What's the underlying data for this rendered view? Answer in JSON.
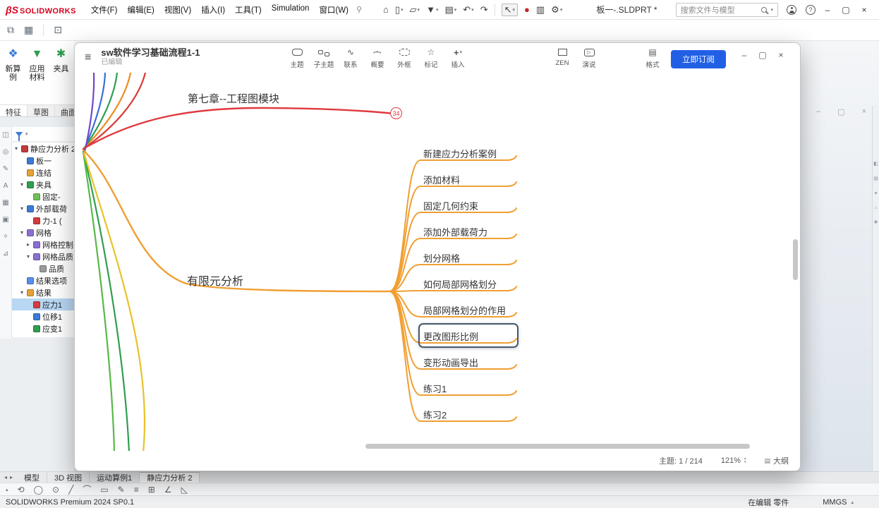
{
  "colors": {
    "brand_red": "#d6001c",
    "subscribe_blue": "#2160e5",
    "branch_orange": "#f09f33",
    "branch_red": "#e0393f",
    "tree_selection_blue": "#b8d7f3"
  },
  "icons": {
    "pin": "⚲",
    "caret": "▾",
    "help": "?",
    "minimize": "–",
    "maximize": "▢",
    "close": "×",
    "hamburger": "≡",
    "relation": "∿",
    "marker": "☆",
    "plus": "+",
    "play": "▷",
    "format": "▤",
    "brace": "{",
    "up": "▴",
    "down": "▾",
    "left": "◂",
    "right": "▸",
    "outline": "▤"
  },
  "qat_icons": {
    "home": "⌂",
    "new": "▯",
    "open": "▱",
    "save": "▼",
    "print": "▤",
    "undo": "↶",
    "redo": "↷",
    "select": "↖",
    "sphere": "●",
    "sheet": "▥",
    "gear": "⚙"
  },
  "row2_icons": [
    "⧉",
    "▦",
    "⊡"
  ],
  "left_strip_icons": [
    "◫",
    "◎",
    "✎",
    "A",
    "▦",
    "▣",
    "✧",
    "⊿"
  ],
  "taskpane_icons": [
    "◧",
    "▤",
    "✦",
    "⌂",
    "❖"
  ],
  "ghost_icons": [
    "⧉",
    "–",
    "▢",
    "×"
  ],
  "sketch_icons": [
    "⟲",
    "◯",
    "⊙",
    "╱",
    "⌒",
    "▭",
    "✎",
    "≡",
    "⊞",
    "∠",
    "◺"
  ],
  "titlebar": {
    "logo_mark": "βS",
    "logo_text": "SOLIDWORKS",
    "menus": [
      "文件(F)",
      "编辑(E)",
      "视图(V)",
      "插入(I)",
      "工具(T)",
      "Simulation",
      "窗口(W)"
    ],
    "doc_title": "板一-.SLDPRT *",
    "search_placeholder": "搜索文件与模型"
  },
  "cmd_panel": {
    "buttons": [
      "新算例",
      "应用材料",
      "夹具"
    ]
  },
  "cmd_tabs": [
    "特征",
    "草图",
    "曲面"
  ],
  "tree": [
    {
      "arrow": "▾",
      "label": "静应力分析 2",
      "icon_style": "background:#c23b3b"
    },
    {
      "arrow": "",
      "label": "板一",
      "icon_style": "background:#3a7bd5"
    },
    {
      "arrow": "",
      "label": "连结",
      "icon_style": "background:#e2a33c"
    },
    {
      "arrow": "▾",
      "label": "夹具",
      "icon_style": "background:#2e9e4f"
    },
    {
      "arrow": "",
      "label": "固定-",
      "icon_style": "background:#6fbf5a"
    },
    {
      "arrow": "▾",
      "label": "外部载荷",
      "icon_style": "background:#3a7bd5"
    },
    {
      "arrow": "",
      "label": "力-1 (",
      "icon_style": "background:#d23c3c"
    },
    {
      "arrow": "▾",
      "label": "网格",
      "icon_style": "background:#8a6fd1"
    },
    {
      "arrow": "▸",
      "label": "网格控制",
      "icon_style": "background:#8a6fd1"
    },
    {
      "arrow": "▾",
      "label": "网格品质",
      "icon_style": "background:#8a6fd1"
    },
    {
      "arrow": "",
      "label": "品质",
      "icon_style": "background:#9a9a9a"
    },
    {
      "arrow": "",
      "label": "结果选项",
      "icon_style": "background:#5b8def"
    },
    {
      "arrow": "▾",
      "label": "结果",
      "icon_style": "background:#e2a33c"
    },
    {
      "arrow": "",
      "label": "应力1",
      "icon_style": "background:#d23c3c"
    },
    {
      "arrow": "",
      "label": "位移1",
      "icon_style": "background:#3a7bd5"
    },
    {
      "arrow": "",
      "label": "应变1",
      "icon_style": "background:#2e9e4f"
    }
  ],
  "doc_tabs": [
    "模型",
    "3D 视图",
    "运动算例1",
    "静应力分析 2"
  ],
  "status_bar": {
    "left": "SOLIDWORKS Premium 2024 SP0.1",
    "editing": "在编辑 零件",
    "units": "MMGS"
  },
  "mindmap": {
    "title": "sw软件学习基础流程1-1",
    "subtitle": "已编辑",
    "toolbar": [
      "主题",
      "子主题",
      "联系",
      "概要",
      "外框",
      "标记",
      "插入"
    ],
    "zen": "ZEN",
    "present": "演说",
    "format": "格式",
    "subscribe": "立即订阅",
    "chapter7": "第七章--工程图模块",
    "badge": "34",
    "fea": "有限元分析",
    "children": [
      "新建应力分析案例",
      "添加材料",
      "固定几何约束",
      "添加外部载荷力",
      "划分网格",
      "如何局部网格划分",
      "局部网格划分的作用",
      "更改图形比例",
      "变形动画导出",
      "练习1",
      "练习2"
    ],
    "status": {
      "topics": "主题: 1 / 214",
      "zoom": "121%",
      "outline": "大纲"
    }
  }
}
